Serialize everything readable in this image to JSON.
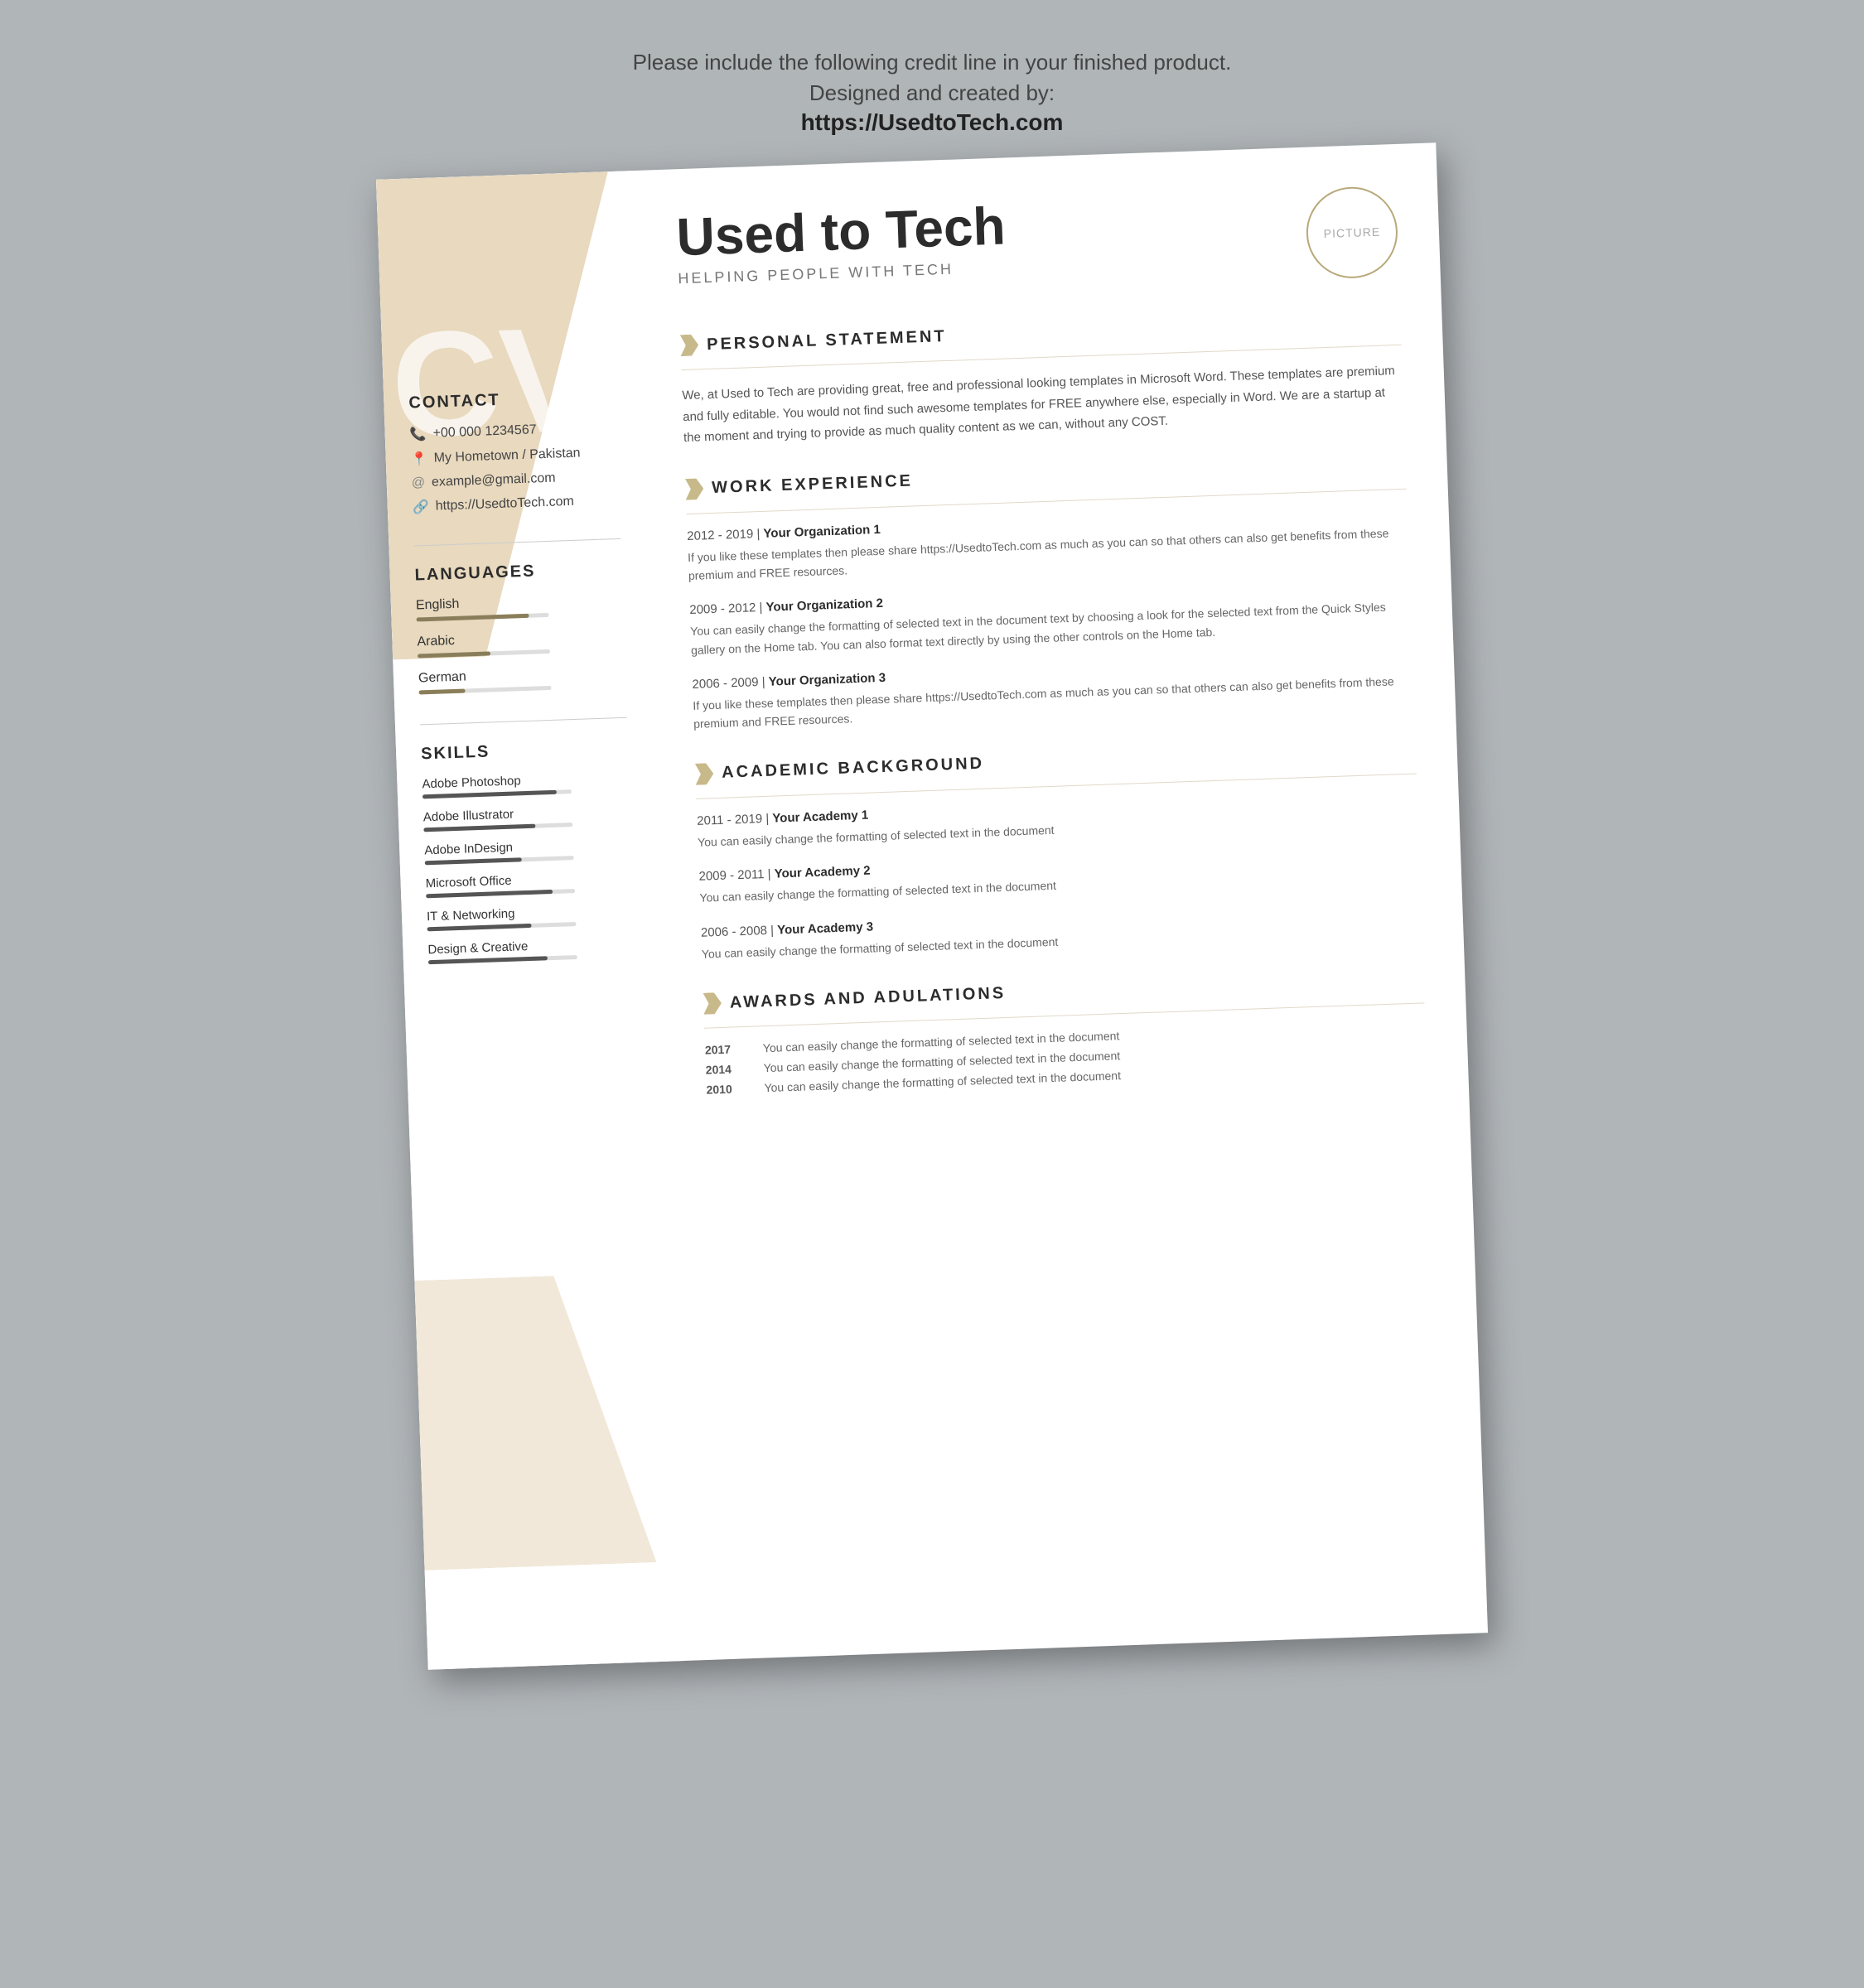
{
  "page": {
    "credit_line": "Please include the following credit line in your finished product.",
    "designed_by": "Designed and created by:",
    "url": "https://UsedtoTech.com"
  },
  "resume": {
    "name": "Used to Tech",
    "title": "HELPING PEOPLE WITH TECH",
    "picture_label": "PICTURE",
    "contact": {
      "title": "CONTACT",
      "phone": "+00 000 1234567",
      "location": "My Hometown / Pakistan",
      "email": "example@gmail.com",
      "website": "https://UsedtoTech.com"
    },
    "languages": {
      "title": "LANGUAGES",
      "items": [
        {
          "name": "English",
          "level": 85
        },
        {
          "name": "Arabic",
          "level": 55
        },
        {
          "name": "German",
          "level": 35
        }
      ]
    },
    "skills": {
      "title": "SKILLS",
      "items": [
        {
          "name": "Adobe Photoshop",
          "level": 90
        },
        {
          "name": "Adobe Illustrator",
          "level": 75
        },
        {
          "name": "Adobe InDesign",
          "level": 65
        },
        {
          "name": "Microsoft Office",
          "level": 85
        },
        {
          "name": "IT & Networking",
          "level": 70
        },
        {
          "name": "Design & Creative",
          "level": 80
        }
      ]
    },
    "personal_statement": {
      "title": "PERSONAL STATEMENT",
      "text": "We, at Used to Tech are providing great, free and professional looking templates in Microsoft Word. These templates are premium and fully editable. You would not find such awesome templates for FREE anywhere else, especially in Word. We are a startup at the moment and trying to provide as much quality content as we can, without any COST."
    },
    "work_experience": {
      "title": "WORK EXPERIENCE",
      "items": [
        {
          "period": "2012 - 2019",
          "org": "Your Organization 1",
          "text": "If you like these templates then please share https://UsedtoTech.com as much as you can so that others can also get benefits from these premium and FREE resources."
        },
        {
          "period": "2009 - 2012",
          "org": "Your Organization 2",
          "text": "You can easily change the formatting of selected text in the document text by choosing a look for the selected text from the Quick Styles gallery on the Home tab. You can also format text directly by using the other controls on the Home tab."
        },
        {
          "period": "2006 - 2009",
          "org": "Your Organization 3",
          "text": "If you like these templates then please share https://UsedtoTech.com as much as you can so that others can also get benefits from these premium and FREE resources."
        }
      ]
    },
    "academic_background": {
      "title": "ACADEMIC BACKGROUND",
      "items": [
        {
          "period": "2011 - 2019",
          "org": "Your Academy 1",
          "text": "You can easily change the formatting of selected text in the document"
        },
        {
          "period": "2009 - 2011",
          "org": "Your Academy 2",
          "text": "You can easily change the formatting of selected text in the document"
        },
        {
          "period": "2006 - 2008",
          "org": "Your Academy 3",
          "text": "You can easily change the formatting of selected text in the document"
        }
      ]
    },
    "awards": {
      "title": "AWARDS AND ADULATIONS",
      "items": [
        {
          "year": "2017",
          "text": "You can easily change the formatting of selected text in the document"
        },
        {
          "year": "2014",
          "text": "You can easily change the formatting of selected text in the document"
        },
        {
          "year": "2010",
          "text": "You can easily change the formatting of selected text in the document"
        }
      ]
    }
  }
}
